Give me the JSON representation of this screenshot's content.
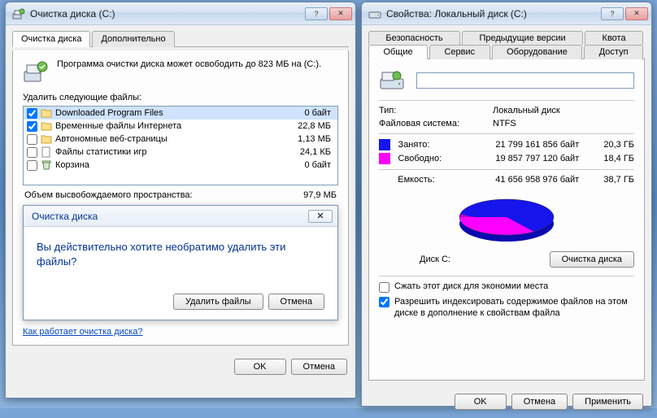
{
  "left": {
    "title": "Очистка диска  (C:)",
    "tabs": [
      "Очистка диска",
      "Дополнительно"
    ],
    "info": "Программа очистки диска может освободить до 823 МБ на  (C:).",
    "delete_label": "Удалить следующие файлы:",
    "files": [
      {
        "checked": true,
        "name": "Downloaded Program Files",
        "size": "0 байт",
        "icon": "folder-icon"
      },
      {
        "checked": true,
        "name": "Временные файлы Интернета",
        "size": "22,8 МБ",
        "icon": "folder-icon"
      },
      {
        "checked": false,
        "name": "Автономные веб-страницы",
        "size": "1,13 МБ",
        "icon": "folder-icon"
      },
      {
        "checked": false,
        "name": "Файлы статистики игр",
        "size": "24,1 КБ",
        "icon": "file-icon"
      },
      {
        "checked": false,
        "name": "Корзина",
        "size": "0 байт",
        "icon": "recycle-icon"
      }
    ],
    "total_label": "Объем высвобождаемого пространства:",
    "total_value": "97,9 МБ",
    "confirm": {
      "title": "Очистка диска",
      "text": "Вы действительно хотите необратимо удалить эти файлы?",
      "delete_btn": "Удалить файлы",
      "cancel_btn": "Отмена"
    },
    "help_link": "Как работает очистка диска?",
    "ok": "OK",
    "cancel": "Отмена"
  },
  "right": {
    "title": "Свойства: Локальный диск (C:)",
    "tabs_row1": [
      "Безопасность",
      "Предыдущие версии",
      "Квота"
    ],
    "tabs_row2": [
      "Общие",
      "Сервис",
      "Оборудование",
      "Доступ"
    ],
    "type_label": "Тип:",
    "type_value": "Локальный диск",
    "fs_label": "Файловая система:",
    "fs_value": "NTFS",
    "used": {
      "label": "Занято:",
      "bytes": "21 799 161 856 байт",
      "gb": "20,3 ГБ",
      "color": "#1515ec"
    },
    "free": {
      "label": "Свободно:",
      "bytes": "19 857 797 120 байт",
      "gb": "18,4 ГБ",
      "color": "#ff00ff"
    },
    "capacity": {
      "label": "Емкость:",
      "bytes": "41 656 958 976 байт",
      "gb": "38,7 ГБ"
    },
    "disk_label": "Диск C:",
    "cleanup_btn": "Очистка диска",
    "compress": "Сжать этот диск для экономии места",
    "index": "Разрешить индексировать содержимое файлов на этом диске в дополнение к свойствам файла",
    "ok": "OK",
    "cancel": "Отмена",
    "apply": "Применить"
  }
}
